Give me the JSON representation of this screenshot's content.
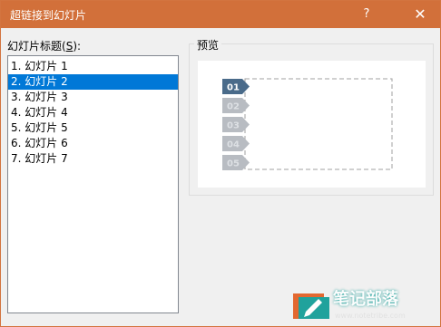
{
  "window": {
    "title": "超链接到幻灯片",
    "help_label": "?",
    "close_label": "✕"
  },
  "slide_list": {
    "label_prefix": "幻灯片标题(",
    "label_key": "S",
    "label_suffix": "):",
    "items": [
      {
        "label": "1. 幻灯片 1",
        "selected": false
      },
      {
        "label": "2. 幻灯片 2",
        "selected": true
      },
      {
        "label": "3. 幻灯片 3",
        "selected": false
      },
      {
        "label": "4. 幻灯片 4",
        "selected": false
      },
      {
        "label": "5. 幻灯片 5",
        "selected": false
      },
      {
        "label": "6. 幻灯片 6",
        "selected": false
      },
      {
        "label": "7. 幻灯片 7",
        "selected": false
      }
    ]
  },
  "preview": {
    "label": "预览",
    "tabs": [
      "01",
      "02",
      "03",
      "04",
      "05"
    ],
    "active_tab": "01",
    "active_color": "#4a6b8a",
    "inactive_color": "#b8bcc2"
  },
  "watermark": {
    "brand": "笔记部落",
    "site": "www.notetribe.com"
  },
  "colors": {
    "titlebar": "#d2703a",
    "selection": "#0078d7"
  }
}
